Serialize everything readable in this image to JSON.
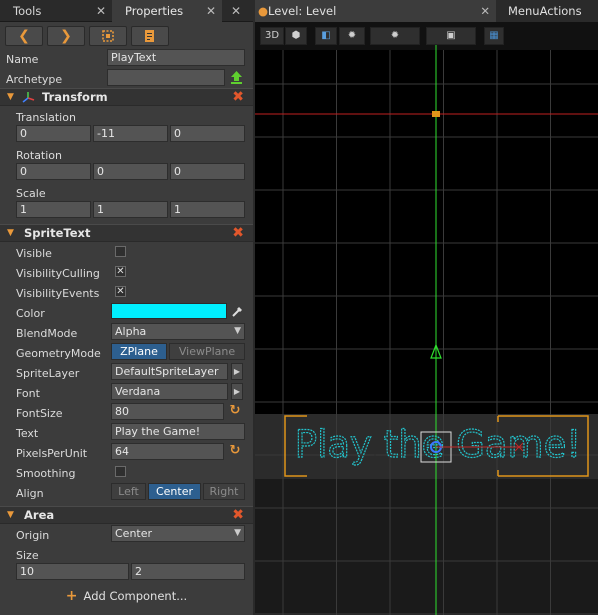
{
  "left_tabs": {
    "tools": "Tools",
    "properties": "Properties",
    "close": "✕"
  },
  "nav": {
    "back": "❮",
    "forward": "❯"
  },
  "name": {
    "label": "Name",
    "value": "PlayText"
  },
  "archetype": {
    "label": "Archetype",
    "value": ""
  },
  "transform": {
    "title": "Transform",
    "translation": {
      "label": "Translation",
      "x": "0",
      "y": "-11",
      "z": "0"
    },
    "rotation": {
      "label": "Rotation",
      "x": "0",
      "y": "0",
      "z": "0"
    },
    "scale": {
      "label": "Scale",
      "x": "1",
      "y": "1",
      "z": "1"
    }
  },
  "spritetext": {
    "title": "SpriteText",
    "visible": {
      "label": "Visible",
      "checked": false
    },
    "visibility_culling": {
      "label": "VisibilityCulling",
      "checked": true
    },
    "visibility_events": {
      "label": "VisibilityEvents",
      "checked": true
    },
    "color": {
      "label": "Color",
      "value": "#00f0ff"
    },
    "blend_mode": {
      "label": "BlendMode",
      "value": "Alpha"
    },
    "geometry_mode": {
      "label": "GeometryMode",
      "options": [
        "ZPlane",
        "ViewPlane"
      ],
      "selected": "ZPlane"
    },
    "sprite_layer": {
      "label": "SpriteLayer",
      "value": "DefaultSpriteLayer"
    },
    "font": {
      "label": "Font",
      "value": "Verdana"
    },
    "font_size": {
      "label": "FontSize",
      "value": "80"
    },
    "text": {
      "label": "Text",
      "value": "Play the Game!"
    },
    "pixels_per_unit": {
      "label": "PixelsPerUnit",
      "value": "64"
    },
    "smoothing": {
      "label": "Smoothing",
      "checked": false
    },
    "align": {
      "label": "Align",
      "options": [
        "Left",
        "Center",
        "Right"
      ],
      "selected": "Center"
    }
  },
  "area": {
    "title": "Area",
    "origin": {
      "label": "Origin",
      "value": "Center"
    },
    "size": {
      "label": "Size",
      "x": "10",
      "y": "2"
    }
  },
  "add_component": "Add Component...",
  "right_tabs": {
    "level": "Level: Level",
    "menu_actions": "MenuActions",
    "close": "✕"
  },
  "viewport": {
    "mode_3d": "3D",
    "rendered_text": "Play the Game!",
    "text_color": "#23c3cc",
    "grid_color": "#3a3a3a",
    "axis_green": "#2fe02f",
    "axis_red": "#c02020",
    "selection_color": "#e0951a"
  },
  "icons": {
    "export": "upload-icon",
    "eyedropper": "eyedropper-icon",
    "reset": "reset-icon"
  }
}
